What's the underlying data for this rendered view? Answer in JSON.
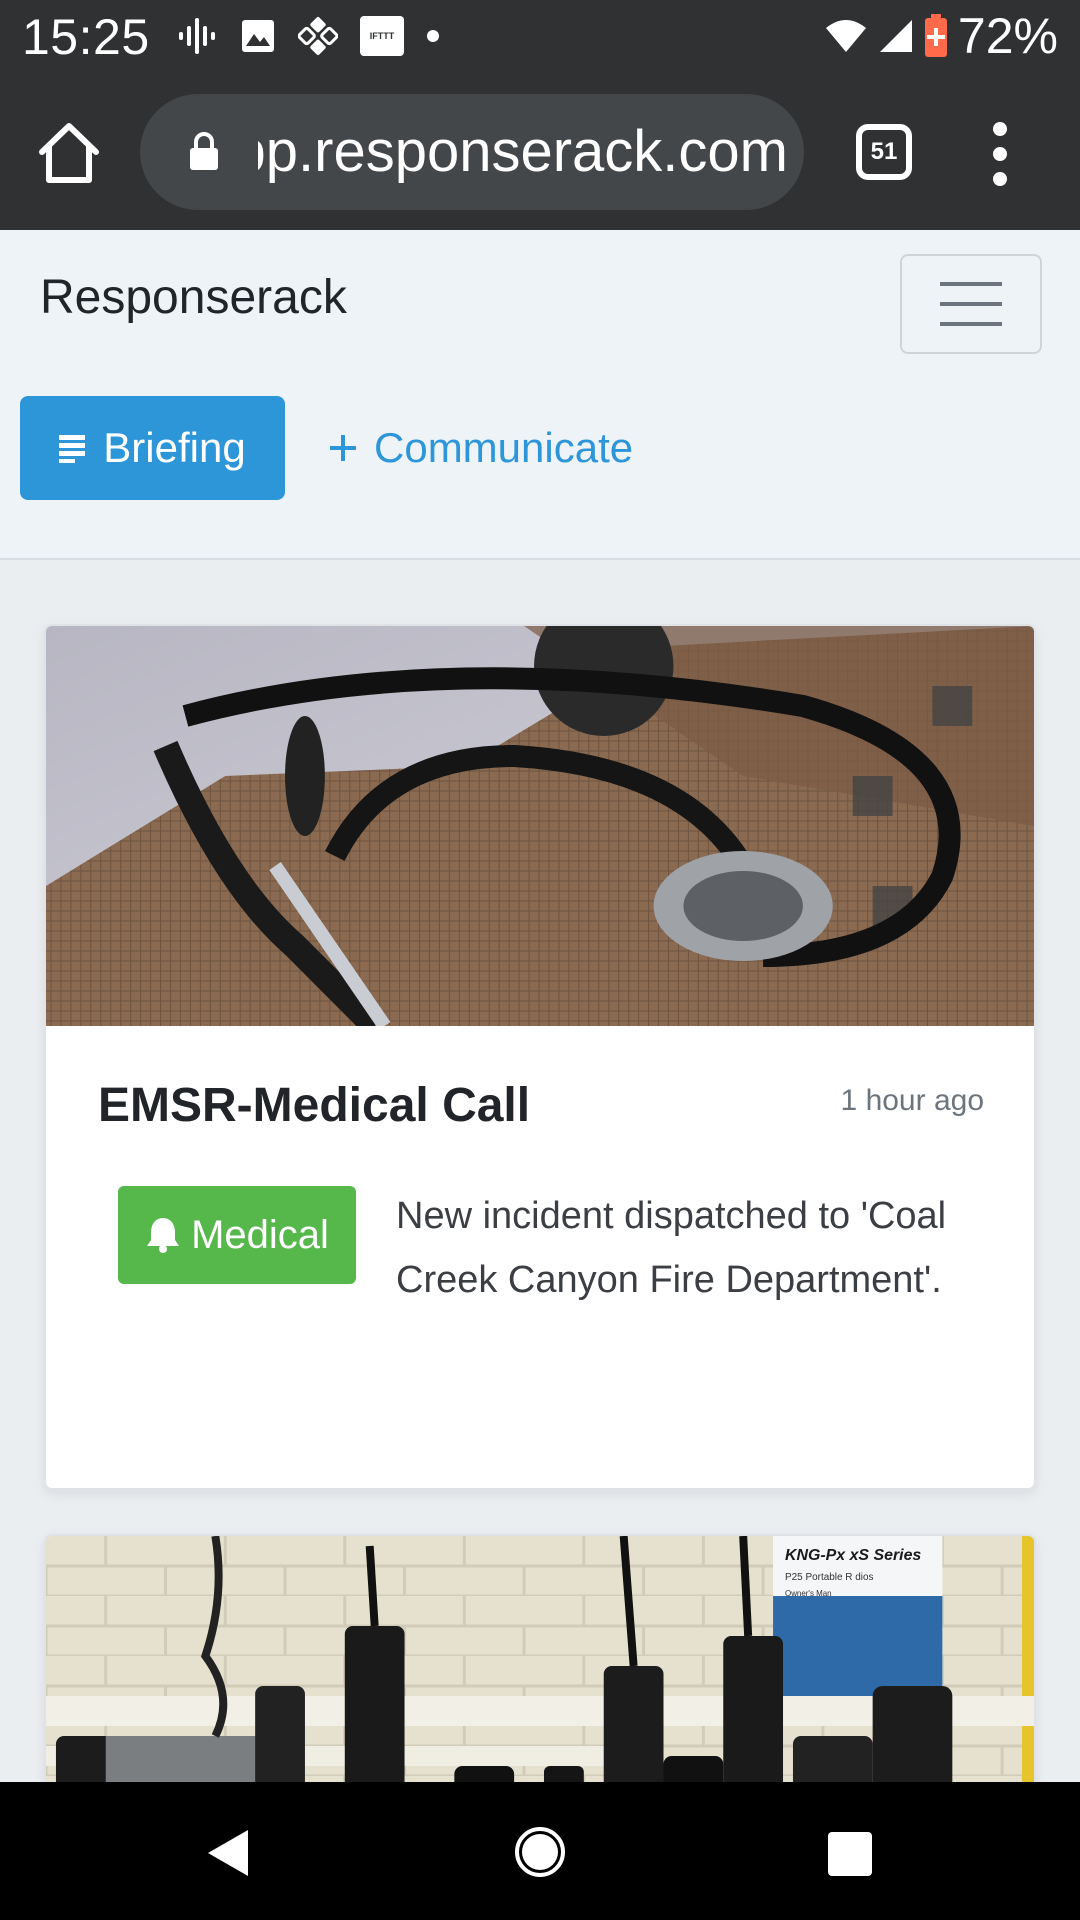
{
  "status_bar": {
    "time": "15:25",
    "battery_percent": "72%",
    "left_icons": [
      "podcast-icon",
      "image-icon",
      "app-grid-icon",
      "ifttt-icon",
      "dot-icon"
    ],
    "ifttt_label": "IFTTT",
    "right_icons": [
      "wifi-icon",
      "cell-signal-icon",
      "battery-charging-icon"
    ]
  },
  "browser": {
    "url": "app.responserack.com",
    "tab_count": "51",
    "icons": {
      "home": "home-icon",
      "lock": "lock-icon",
      "menu": "more-vertical-icon"
    }
  },
  "site": {
    "brand": "Responserack",
    "nav": {
      "briefing_label": "Briefing",
      "communicate_label": "Communicate"
    }
  },
  "cards": [
    {
      "title": "EMSR-Medical Call",
      "time": "1 hour ago",
      "badge_label": "Medical",
      "badge_color": "#56b84b",
      "description": "New incident dispatched to 'Coal Creek Canyon Fire Department'.",
      "image": "stethoscope-photo"
    },
    {
      "image": "radios-photo",
      "image_text_1": "KNG-Px  xS Series",
      "image_text_2": "P25 Portable R  dios",
      "image_text_3": "Owner's Man"
    }
  ],
  "colors": {
    "primary": "#2d96d8",
    "success": "#56b84b",
    "system_bar": "#2f3133"
  }
}
